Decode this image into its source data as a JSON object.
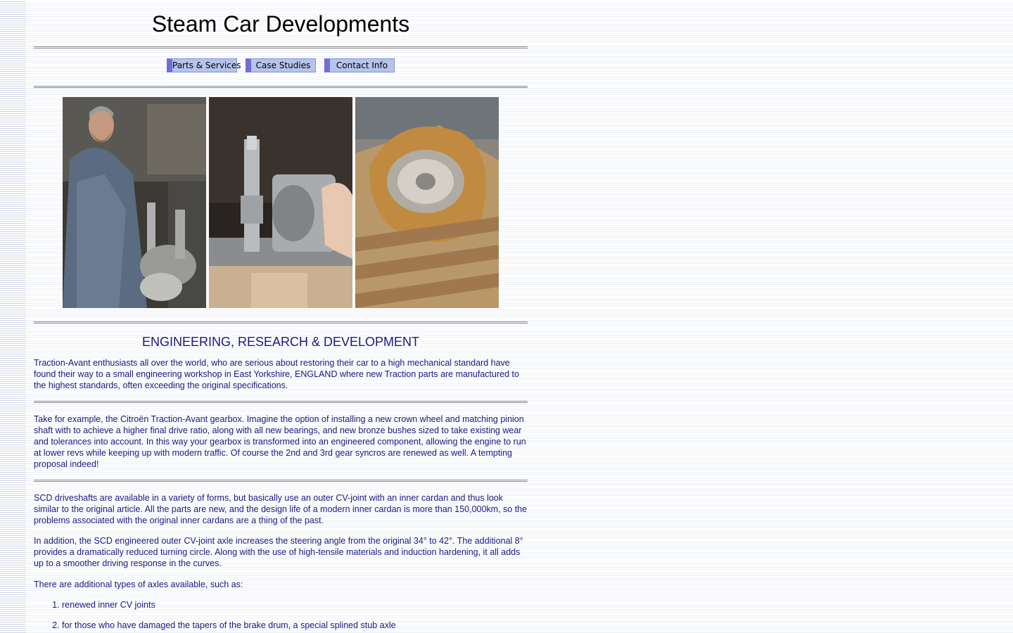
{
  "site": {
    "title": "Steam Car Developments"
  },
  "nav": [
    {
      "label": "Parts & Services"
    },
    {
      "label": "Case Studies"
    },
    {
      "label": "Contact Info"
    }
  ],
  "photos": [
    {
      "alt_icon": "mechanic-photo"
    },
    {
      "alt_icon": "gear-shaft-photo"
    },
    {
      "alt_icon": "crown-wheel-box-photo"
    }
  ],
  "main": {
    "heading": "ENGINEERING, RESEARCH & DEVELOPMENT",
    "paragraphs": [
      "Traction-Avant enthusiasts all over the world, who are serious about restoring their car to a high mechanical standard have found their way to a small engineering workshop in East Yorkshire, ENGLAND where new Traction parts are manufactured to the highest standards, often exceeding the original specifications.",
      "Take for example, the Citroën Traction-Avant gearbox.  Imagine the option of installing a new crown wheel and matching pinion shaft with to achieve a higher final drive ratio, along with all new bearings, and new bronze bushes sized to take existing wear and tolerances into account.  In this way your gearbox is transformed into an engineered component, allowing the engine to run at lower revs while keeping up with modern traffic.  Of course the 2nd and 3rd gear syncros are renewed as well.  A tempting proposal indeed!",
      "SCD driveshafts are available in a variety of forms, but basically use an outer CV-joint with an inner cardan and thus look similar to the original article.  All the parts are new, and the design life of a modern inner cardan is more than 150,000km, so the problems associated with the original inner cardans are a thing of the past.",
      "In addition, the SCD engineered outer CV-joint axle increases the steering angle from the original 34° to 42°.  The additional 8° provides a dramatically reduced turning circle.  Along with the use of high-tensile materials and induction hardening, it all adds up to a smoother driving response in the curves.",
      "There are additional types of axles available, such as:"
    ],
    "list": [
      "renewed inner CV joints",
      "for those who have damaged the tapers of the brake drum, a special splined stub axle"
    ]
  }
}
